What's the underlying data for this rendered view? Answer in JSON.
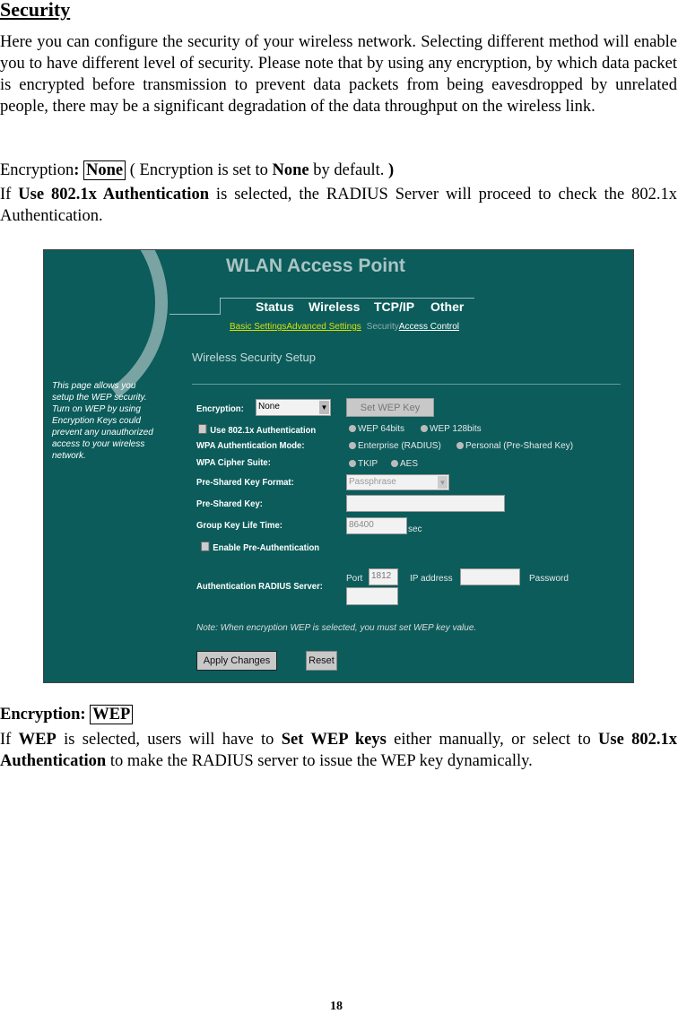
{
  "heading": "Security",
  "intro": "Here you can configure the security of your wireless network. Selecting different method will enable you to have different level of security.  Please note that by using any encryption, by which data packet is encrypted before transmission to prevent data packets from being eavesdropped by unrelated people, there may be a significant degradation of the data throughput on the wireless link.",
  "enc_none": {
    "label": "Encryption",
    "colon": ":",
    "value": "None",
    "note_pre": " ( Encryption is set to ",
    "note_bold": "None",
    "note_post": " by default. ",
    "paren": ")"
  },
  "auth_line": {
    "pre": "If ",
    "bold": "Use 802.1x Authentication",
    "post": " is selected, the RADIUS Server will proceed to check the 802.1x Authentication."
  },
  "screenshot": {
    "title": "WLAN Access Point",
    "tabs": [
      "Status",
      "Wireless",
      "TCP/IP",
      "Other"
    ],
    "subtabs": [
      "Basic Settings",
      "Advanced Settings",
      "Security",
      "Access Control"
    ],
    "page_title": "Wireless Security Setup",
    "sidebar_text": "This page allows you setup the WEP security. Turn on WEP by using Encryption Keys could prevent any unauthorized access to your wireless network.",
    "encryption_label": "Encryption:",
    "encryption_value": "None",
    "set_wep_key": "Set WEP Key",
    "use_8021x": "Use 802.1x Authentication",
    "wep64": "WEP 64bits",
    "wep128": "WEP 128bits",
    "wpa_mode_label": "WPA Authentication Mode:",
    "enterprise": "Enterprise (RADIUS)",
    "personal": "Personal (Pre-Shared Key)",
    "cipher_label": "WPA Cipher Suite:",
    "tkip": "TKIP",
    "aes": "AES",
    "psk_format_label": "Pre-Shared Key Format:",
    "psk_format_value": "Passphrase",
    "psk_label": "Pre-Shared Key:",
    "psk_value": "",
    "group_label": "Group Key Life Time:",
    "group_value": "86400",
    "group_unit": "sec",
    "preauth": "Enable Pre-Authentication",
    "radius_label": "Authentication RADIUS Server:",
    "port_label": "Port",
    "port_value": "1812",
    "ip_label": "IP address",
    "ip_value": "",
    "password_label": "Password",
    "password_value": "",
    "note": "Note: When encryption WEP is selected, you must set WEP key value.",
    "apply": "Apply Changes",
    "reset": "Reset"
  },
  "enc_wep": {
    "label": "Encryption: ",
    "value": "WEP"
  },
  "wep_line": {
    "p1": "If ",
    "b1": "WEP",
    "p2": " is selected, users will have to ",
    "b2": "Set WEP keys",
    "p3": " either manually, or select to ",
    "b3": "Use 802.1x Authentication",
    "p4": " to make the RADIUS server to issue the WEP key dynamically."
  },
  "page_number": "18"
}
